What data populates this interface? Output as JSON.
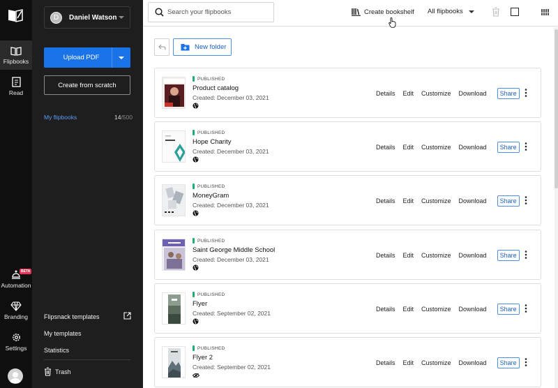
{
  "rail": {
    "items": [
      {
        "label": "Flipbooks",
        "icon": "book-open-icon"
      },
      {
        "label": "Read",
        "icon": "document-icon"
      },
      {
        "label": "Automation",
        "icon": "robot-icon",
        "badge": "BETA"
      },
      {
        "label": "Branding",
        "icon": "diamond-icon"
      },
      {
        "label": "Settings",
        "icon": "gear-icon"
      }
    ]
  },
  "panel": {
    "user_initial": "D",
    "user_name": "Daniel Watson",
    "upload_label": "Upload PDF",
    "scratch_label": "Create from scratch",
    "my_flipbooks_label": "My flipbooks",
    "count_current": "14",
    "count_total": "/500",
    "links": [
      "Flipsnack templates",
      "My templates",
      "Statistics"
    ],
    "trash_label": "Trash"
  },
  "topbar": {
    "search_placeholder": "Search your flipbooks",
    "create_bookshelf": "Create bookshelf",
    "filter_label": "All flipbooks"
  },
  "main": {
    "new_folder_label": "New folder",
    "actions": [
      "Details",
      "Edit",
      "Customize",
      "Download"
    ],
    "share_label": "Share",
    "rows": [
      {
        "status": "PUBLISHED",
        "title": "Product catalog",
        "created": "Created: December 03, 2021",
        "visibility": "globe-icon"
      },
      {
        "status": "PUBLISHED",
        "title": "Hope Charity",
        "created": "Created: December 03, 2021",
        "visibility": "globe-icon"
      },
      {
        "status": "PUBLISHED",
        "title": "MoneyGram",
        "created": "Created: December 03, 2021",
        "visibility": "globe-icon"
      },
      {
        "status": "PUBLISHED",
        "title": "Saint George Middle School",
        "created": "Created: December 03, 2021",
        "visibility": "globe-icon"
      },
      {
        "status": "PUBLISHED",
        "title": "Flyer",
        "created": "Created: September 02, 2021",
        "visibility": "globe-icon"
      },
      {
        "status": "PUBLISHED",
        "title": "Flyer 2",
        "created": "Created: September 02, 2021",
        "visibility": "eye-slash-icon"
      }
    ]
  },
  "colors": {
    "accent": "#1a73e8",
    "published": "#1fae72",
    "rail_bg": "#0f0f0f",
    "panel_bg": "#1e1e1e"
  }
}
